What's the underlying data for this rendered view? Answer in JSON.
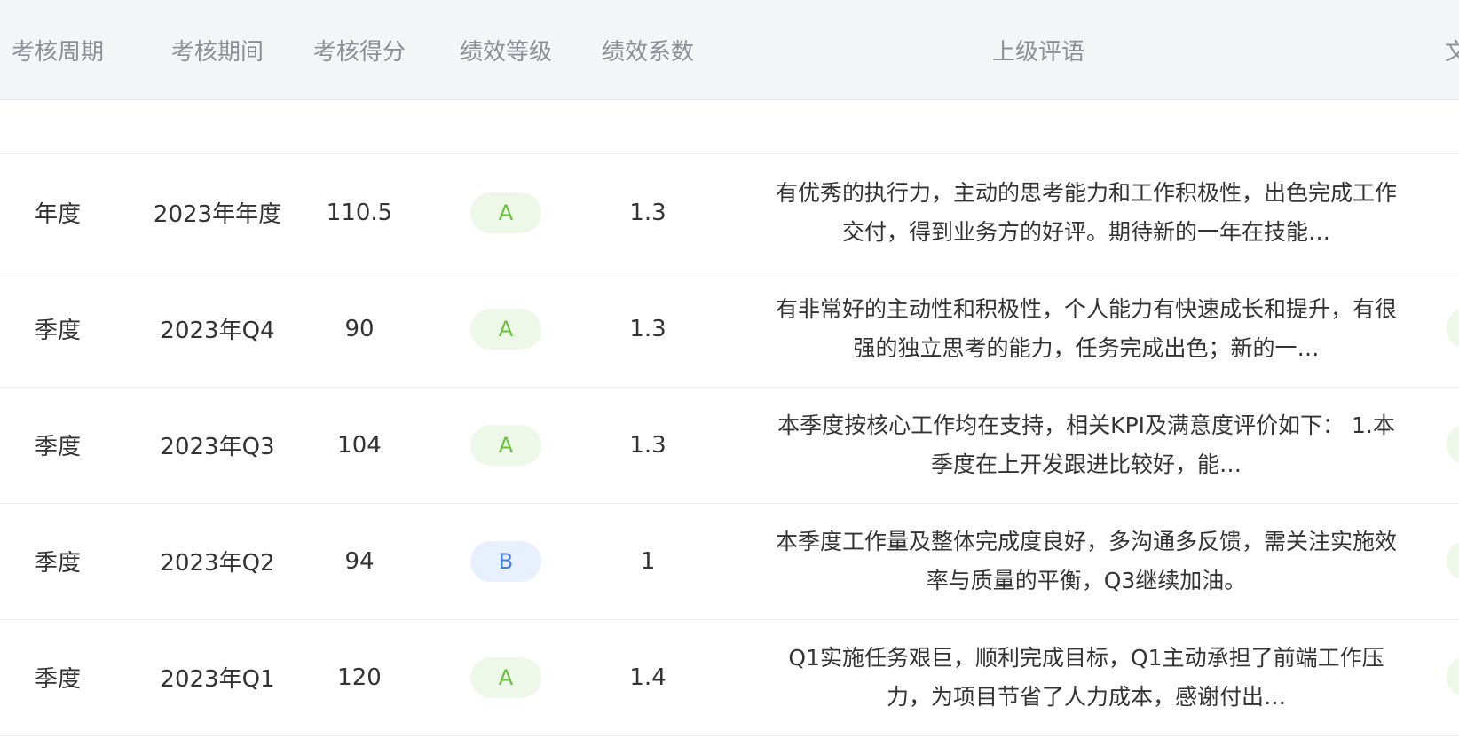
{
  "columns": [
    "考核周期",
    "考核期间",
    "考核得分",
    "绩效等级",
    "绩效系数",
    "上级评语",
    "文"
  ],
  "rows": [
    {
      "cycle": "年度",
      "period": "2023年年度",
      "score": "110.5",
      "grade": "A",
      "coef": "1.3",
      "comment": "有优秀的执行力，主动的思考能力和工作积极性，出色完成工作交付，得到业务方的好评。期待新的一年在技能…"
    },
    {
      "cycle": "季度",
      "period": "2023年Q4",
      "score": "90",
      "grade": "A",
      "coef": "1.3",
      "comment": "有非常好的主动性和积极性，个人能力有快速成长和提升，有很强的独立思考的能力，任务完成出色；新的一…"
    },
    {
      "cycle": "季度",
      "period": "2023年Q3",
      "score": "104",
      "grade": "A",
      "coef": "1.3",
      "comment": "本季度按核心工作均在支持，相关KPI及满意度评价如下： 1.本季度在上开发跟进比较好，能…"
    },
    {
      "cycle": "季度",
      "period": "2023年Q2",
      "score": "94",
      "grade": "B",
      "coef": "1",
      "comment": "本季度工作量及整体完成度良好，多沟通多反馈，需关注实施效率与质量的平衡，Q3继续加油。"
    },
    {
      "cycle": "季度",
      "period": "2023年Q1",
      "score": "120",
      "grade": "A",
      "coef": "1.4",
      "comment": "Q1实施任务艰巨，顺利完成目标，Q1主动承担了前端工作压力，为项目节省了人力成本，感谢付出…"
    }
  ],
  "colors": {
    "header_bg": "#f4f5f7",
    "header_text": "#8c8f95",
    "grade_a_bg": "#eef8e8",
    "grade_a_text": "#67c23a",
    "grade_b_bg": "#e8f0fd",
    "grade_b_text": "#3f7ee8"
  }
}
